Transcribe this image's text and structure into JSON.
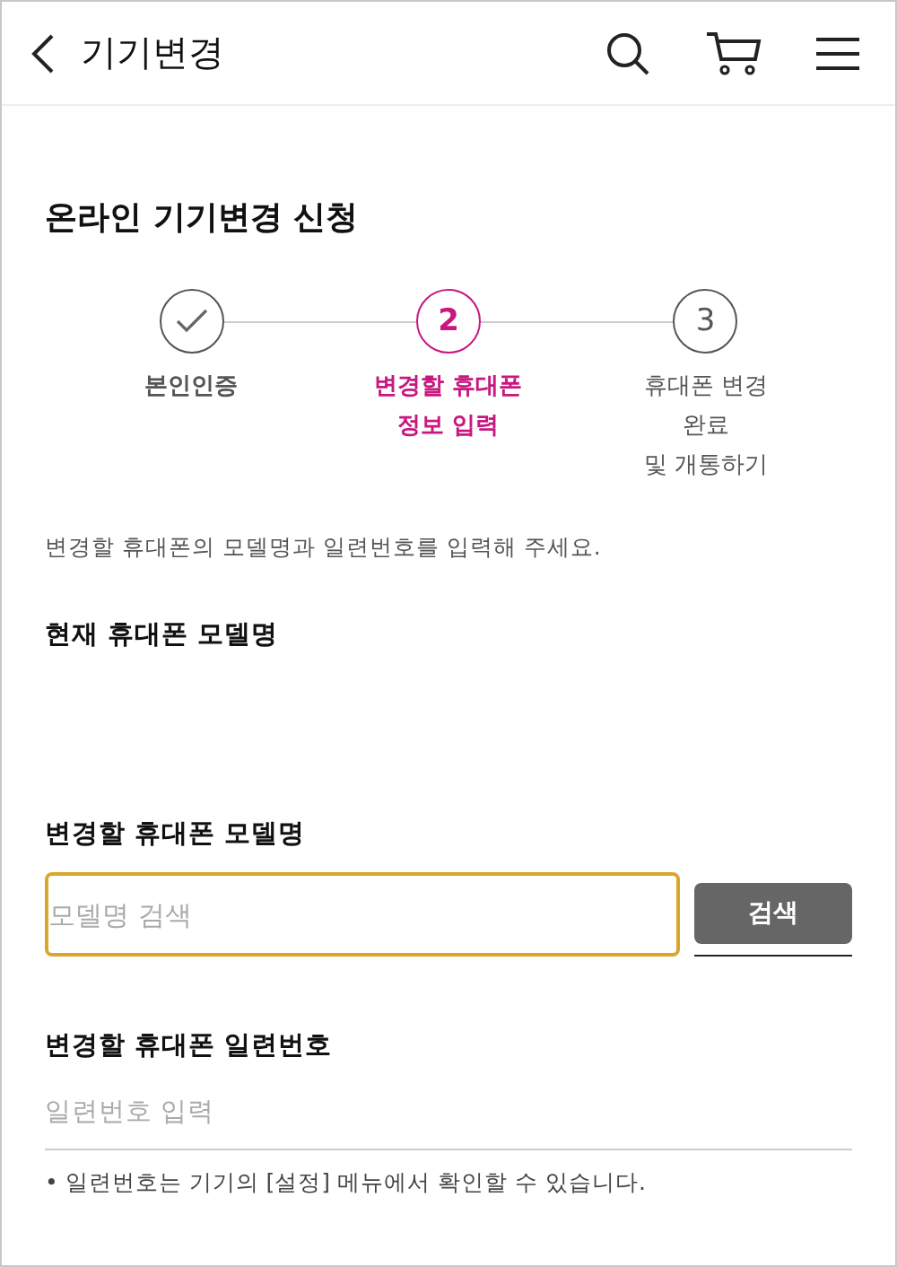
{
  "header": {
    "title": "기기변경"
  },
  "page_title": "온라인 기기변경 신청",
  "steps": [
    {
      "label": "본인인증",
      "kind": "done"
    },
    {
      "number": "2",
      "label": "변경할 휴대폰\n정보 입력",
      "kind": "current"
    },
    {
      "number": "3",
      "label": "휴대폰 변경\n완료\n및 개통하기",
      "kind": "upcoming"
    }
  ],
  "description": "변경할 휴대폰의 모델명과 일련번호를 입력해 주세요.",
  "current_model": {
    "label": "현재 휴대폰 모델명"
  },
  "new_model": {
    "label": "변경할 휴대폰 모델명",
    "placeholder": "모델명 검색",
    "focused": true,
    "button": "검색"
  },
  "serial": {
    "label": "변경할 휴대폰 일련번호",
    "placeholder": "일련번호 입력"
  },
  "note": "• 일련번호는 기기의 [설정] 메뉴에서 확인할 수 있습니다."
}
